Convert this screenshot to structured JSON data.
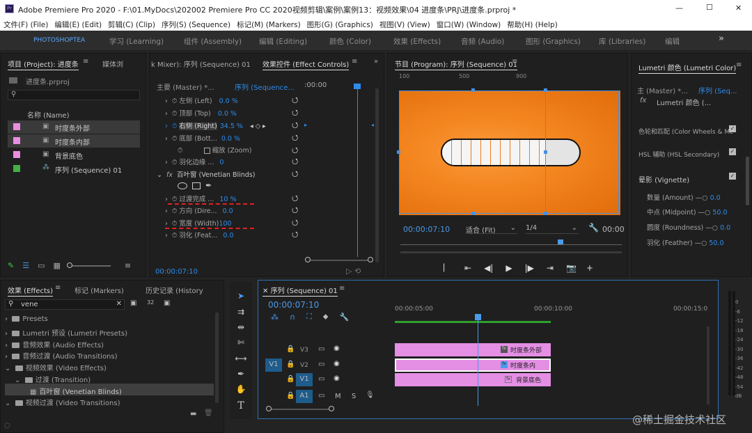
{
  "titlebar": {
    "title": "Adobe Premiere Pro 2020 - F:\\01.MyDocs\\202002 Premiere Pro CC 2020视频剪辑\\案例\\案例13：视频效果\\04 进度条\\PRJ\\进度条.prproj *",
    "min": "—",
    "max": "☐",
    "close": "✕"
  },
  "menu": [
    "文件(F) (File)",
    "编辑(E) (Edit)",
    "剪辑(C) (Clip)",
    "序列(S) (Sequence)",
    "标记(M) (Markers)",
    "图形(G) (Graphics)",
    "视图(V) (View)",
    "窗口(W) (Window)",
    "帮助(H) (Help)"
  ],
  "workspaces": [
    "PHOTOSHOPTEA",
    "学习 (Learning)",
    "组件 (Assembly)",
    "编辑 (Editing)",
    "颜色 (Color)",
    "效果 (Effects)",
    "音频 (Audio)",
    "图形 (Graphics)",
    "库 (Libraries)",
    "编辑"
  ],
  "workspace_more": "»",
  "project": {
    "tab": "项目 (Project): 进度条",
    "tab_menu": "≡",
    "tab2": "媒体浏",
    "file": "进度条.prproj",
    "col_name": "名称 (Name)",
    "items": [
      {
        "label": "时度条外部",
        "color": "#e88ee0"
      },
      {
        "label": "时度条内部",
        "color": "#e88ee0"
      },
      {
        "label": "背景底色",
        "color": "#e88ee0"
      },
      {
        "label": "序列 (Sequence) 01",
        "color": "#45b045"
      }
    ]
  },
  "ec": {
    "tab_left": "k Mixer): 序列 (Sequence) 01",
    "tab": "效果控件 (Effect Controls)",
    "tab_menu": "≡",
    "master": "主要 (Master) *...",
    "seq": "序列 (Sequence...",
    "timecode": ":00:00",
    "rows": [
      {
        "label": "左侧 (Left)",
        "value": "0.0 %"
      },
      {
        "label": "顶部 (Top)",
        "value": "0.0 %"
      },
      {
        "label": "右侧 (Right)",
        "value": "34.5 %"
      },
      {
        "label": "底部 (Bott...",
        "value": "0.0 %"
      },
      {
        "label": "缩放 (Zoom)",
        "value": ""
      },
      {
        "label": "羽化边缘 ...",
        "value": "0"
      }
    ],
    "fx_name": "百叶窗 (Venetian Blinds)",
    "fx_label": "fx",
    "rows2": [
      {
        "label": "过渡完成 ...",
        "value": "10 %"
      },
      {
        "label": "方向 (Dire...",
        "value": "0.0"
      },
      {
        "label": "宽度 (Width)",
        "value": "100"
      },
      {
        "label": "羽化 (Feat...",
        "value": "0.0"
      }
    ],
    "footer_tc": "00:00:07:10"
  },
  "program": {
    "tab": "节目 (Program): 序列 (Sequence) 01",
    "tab_menu": "≡",
    "ruler": [
      "100",
      "500",
      "900"
    ],
    "timecode": "00:00:07:10",
    "fit": "适合 (Fit)",
    "res": "1/4",
    "tc_right": "00:00"
  },
  "lumetri": {
    "tab": "Lumetri 颜色 (Lumetri Color)",
    "tab_menu": "≡",
    "master": "主 (Master) *...",
    "seq": "序列 (Seq...",
    "fx": "Lumetri 颜色 (...",
    "sections": [
      "色轮和匹配 (Color Wheels & Mc",
      "HSL 辅助 (HSL Secondary)",
      "晕影 (Vignette)"
    ],
    "params": [
      {
        "label": "数量 (Amount)",
        "value": "0.0"
      },
      {
        "label": "中点 (Midpoint)",
        "value": "50.0"
      },
      {
        "label": "圆度 (Roundness)",
        "value": "0.0"
      },
      {
        "label": "羽化 (Feather)",
        "value": "50.0"
      }
    ]
  },
  "effects": {
    "tab": "效果 (Effects)",
    "tab_menu": "≡",
    "tab2": "标记 (Markers)",
    "tab3": "历史记录 (History",
    "search": "vene",
    "tree": [
      {
        "label": "Presets",
        "lvl": 0
      },
      {
        "label": "Lumetri 预设 (Lumetri Presets)",
        "lvl": 0
      },
      {
        "label": "音频效果 (Audio Effects)",
        "lvl": 0
      },
      {
        "label": "音频过渡 (Audio Transitions)",
        "lvl": 0
      },
      {
        "label": "视频效果 (Video Effects)",
        "lvl": 0
      },
      {
        "label": "过渡 (Transition)",
        "lvl": 1
      },
      {
        "label": "百叶窗 (Venetian Blinds)",
        "lvl": 2
      },
      {
        "label": "视频过渡 (Video Transitions)",
        "lvl": 0
      }
    ]
  },
  "timeline": {
    "tab": "序列 (Sequence) 01",
    "tab_menu": "≡",
    "timecode": "00:00:07:10",
    "ruler": [
      "00:00:05:00",
      "00:00:10:00",
      "00:00:15:0"
    ],
    "tracks": [
      {
        "name": "V3",
        "clip": "时度条外部"
      },
      {
        "name": "V2",
        "clip": "时度条内"
      },
      {
        "name": "V1",
        "clip": "背景底色"
      }
    ],
    "audio": "A1",
    "src_v": "V1",
    "src_a": "A1",
    "m": "M",
    "s": "S",
    "meter": [
      "0",
      "-6",
      "-12",
      "-18",
      "-24",
      "-30",
      "-36",
      "-42",
      "-48",
      "-54",
      "dB"
    ]
  },
  "watermark": "@稀土掘金技术社区"
}
